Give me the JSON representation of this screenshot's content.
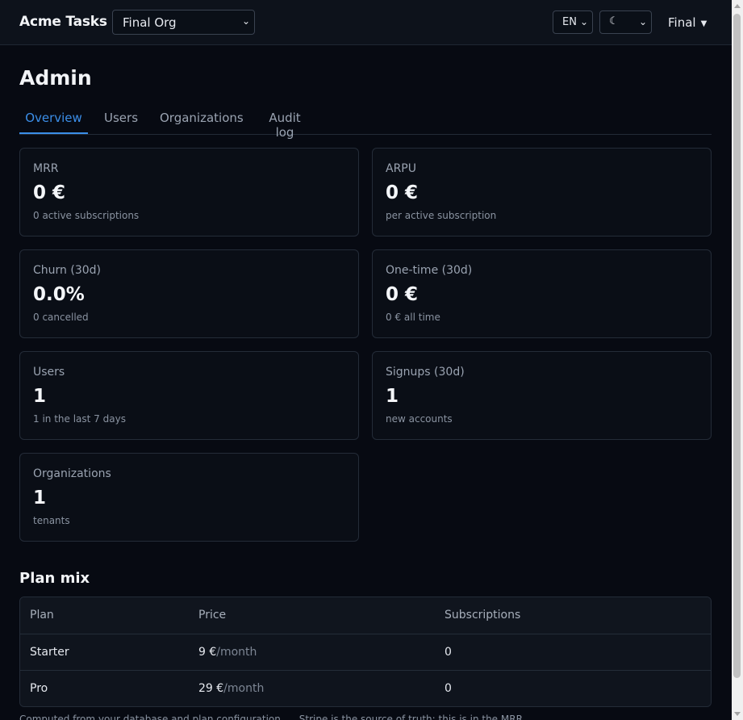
{
  "app": {
    "title": "Acme Tasks"
  },
  "header": {
    "org_select_value": "Final Org",
    "lang_select_value": "EN",
    "theme_select_value": "☾",
    "user_menu_label": "Final"
  },
  "page": {
    "title": "Admin"
  },
  "tabs": [
    {
      "label": "Overview",
      "active": true
    },
    {
      "label": "Users",
      "active": false
    },
    {
      "label": "Organizations",
      "active": false
    },
    {
      "label": "Audit log",
      "active": false
    }
  ],
  "stats": [
    {
      "label": "MRR",
      "value": "0 €",
      "sub": "0 active subscriptions"
    },
    {
      "label": "ARPU",
      "value": "0 €",
      "sub": "per active subscription"
    },
    {
      "label": "Churn (30d)",
      "value": "0.0%",
      "sub": "0 cancelled"
    },
    {
      "label": "One-time (30d)",
      "value": "0 €",
      "sub": "0 € all time"
    },
    {
      "label": "Users",
      "value": "1",
      "sub": "1 in the last 7 days"
    },
    {
      "label": "Signups (30d)",
      "value": "1",
      "sub": "new accounts"
    },
    {
      "label": "Organizations",
      "value": "1",
      "sub": "tenants"
    }
  ],
  "plan_mix": {
    "title": "Plan mix",
    "columns": [
      "Plan",
      "Price",
      "Subscriptions"
    ],
    "rows": [
      {
        "plan": "Starter",
        "price": "9 €",
        "period": "/month",
        "subscriptions": "0"
      },
      {
        "plan": "Pro",
        "price": "29 €",
        "period": "/month",
        "subscriptions": "0"
      }
    ]
  },
  "footnote": "Computed from your database and plan configuration. ... Stripe is the source of truth; this is in the MRR."
}
